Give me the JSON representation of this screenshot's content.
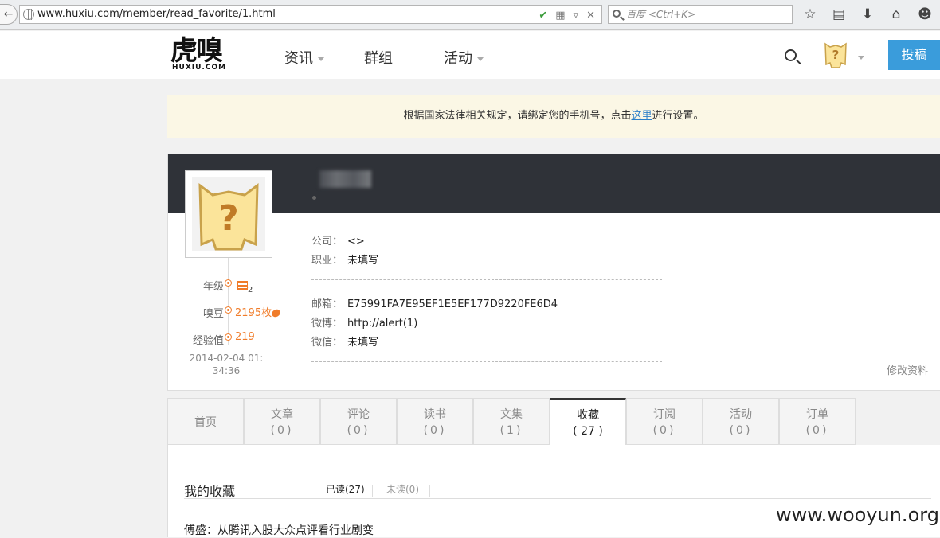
{
  "browser": {
    "url": "www.huxiu.com/member/read_favorite/1.html",
    "search_placeholder": "百度 <Ctrl+K>",
    "icons": [
      "back-icon",
      "globe-icon",
      "shield-icon",
      "qr-icon",
      "dropdown-icon",
      "close-icon",
      "search-icon",
      "star-icon",
      "reading-list-icon",
      "download-icon",
      "home-icon",
      "smiley-icon"
    ]
  },
  "header": {
    "logo_main": "虎嗅",
    "logo_sub": "HUXIU.COM",
    "nav": [
      {
        "label": "资讯",
        "has_caret": true
      },
      {
        "label": "群组",
        "has_caret": false
      },
      {
        "label": "活动",
        "has_caret": true
      }
    ],
    "submit_label": "投稿"
  },
  "notice": {
    "before": "根据国家法律相关规定，请绑定您的手机号，点击",
    "link": "这里",
    "after": "进行设置。"
  },
  "profile": {
    "stats": [
      {
        "label": "年级",
        "value": "2"
      },
      {
        "label": "嗅豆",
        "value": "2195枚"
      },
      {
        "label": "经验值",
        "value": "219"
      }
    ],
    "joined_date": "2014-02-04 01:",
    "joined_time": "34:36",
    "company_label": "公司：",
    "company_value": "<>",
    "job_label": "职业：",
    "job_value": "未填写",
    "email_label": "邮箱：",
    "email_value": "E75991FA7E95EF1E5EF177D9220FE6D4",
    "weibo_label": "微博：",
    "weibo_value": "http://alert(1)",
    "wechat_label": "微信：",
    "wechat_value": "未填写",
    "edit_label": "修改资料"
  },
  "tabs": [
    {
      "label": "首页",
      "count": ""
    },
    {
      "label": "文章",
      "count": "(0)"
    },
    {
      "label": "评论",
      "count": "(0)"
    },
    {
      "label": "读书",
      "count": "(0)"
    },
    {
      "label": "文集",
      "count": "(1)"
    },
    {
      "label": "收藏",
      "count": "( 27 )"
    },
    {
      "label": "订阅",
      "count": "(0)"
    },
    {
      "label": "活动",
      "count": "(0)"
    },
    {
      "label": "订单",
      "count": "(0)"
    }
  ],
  "favorites": {
    "title": "我的收藏",
    "read_tab": "已读(27)",
    "unread_tab": "未读(0)",
    "first_item": "傅盛：从腾讯入股大众点评看行业剧变"
  },
  "watermark": "www.wooyun.org",
  "colors": {
    "accent": "#3a9cdb",
    "orange": "#f07c2a",
    "banner": "#2f3238",
    "notice_bg": "#fbf7e5"
  }
}
